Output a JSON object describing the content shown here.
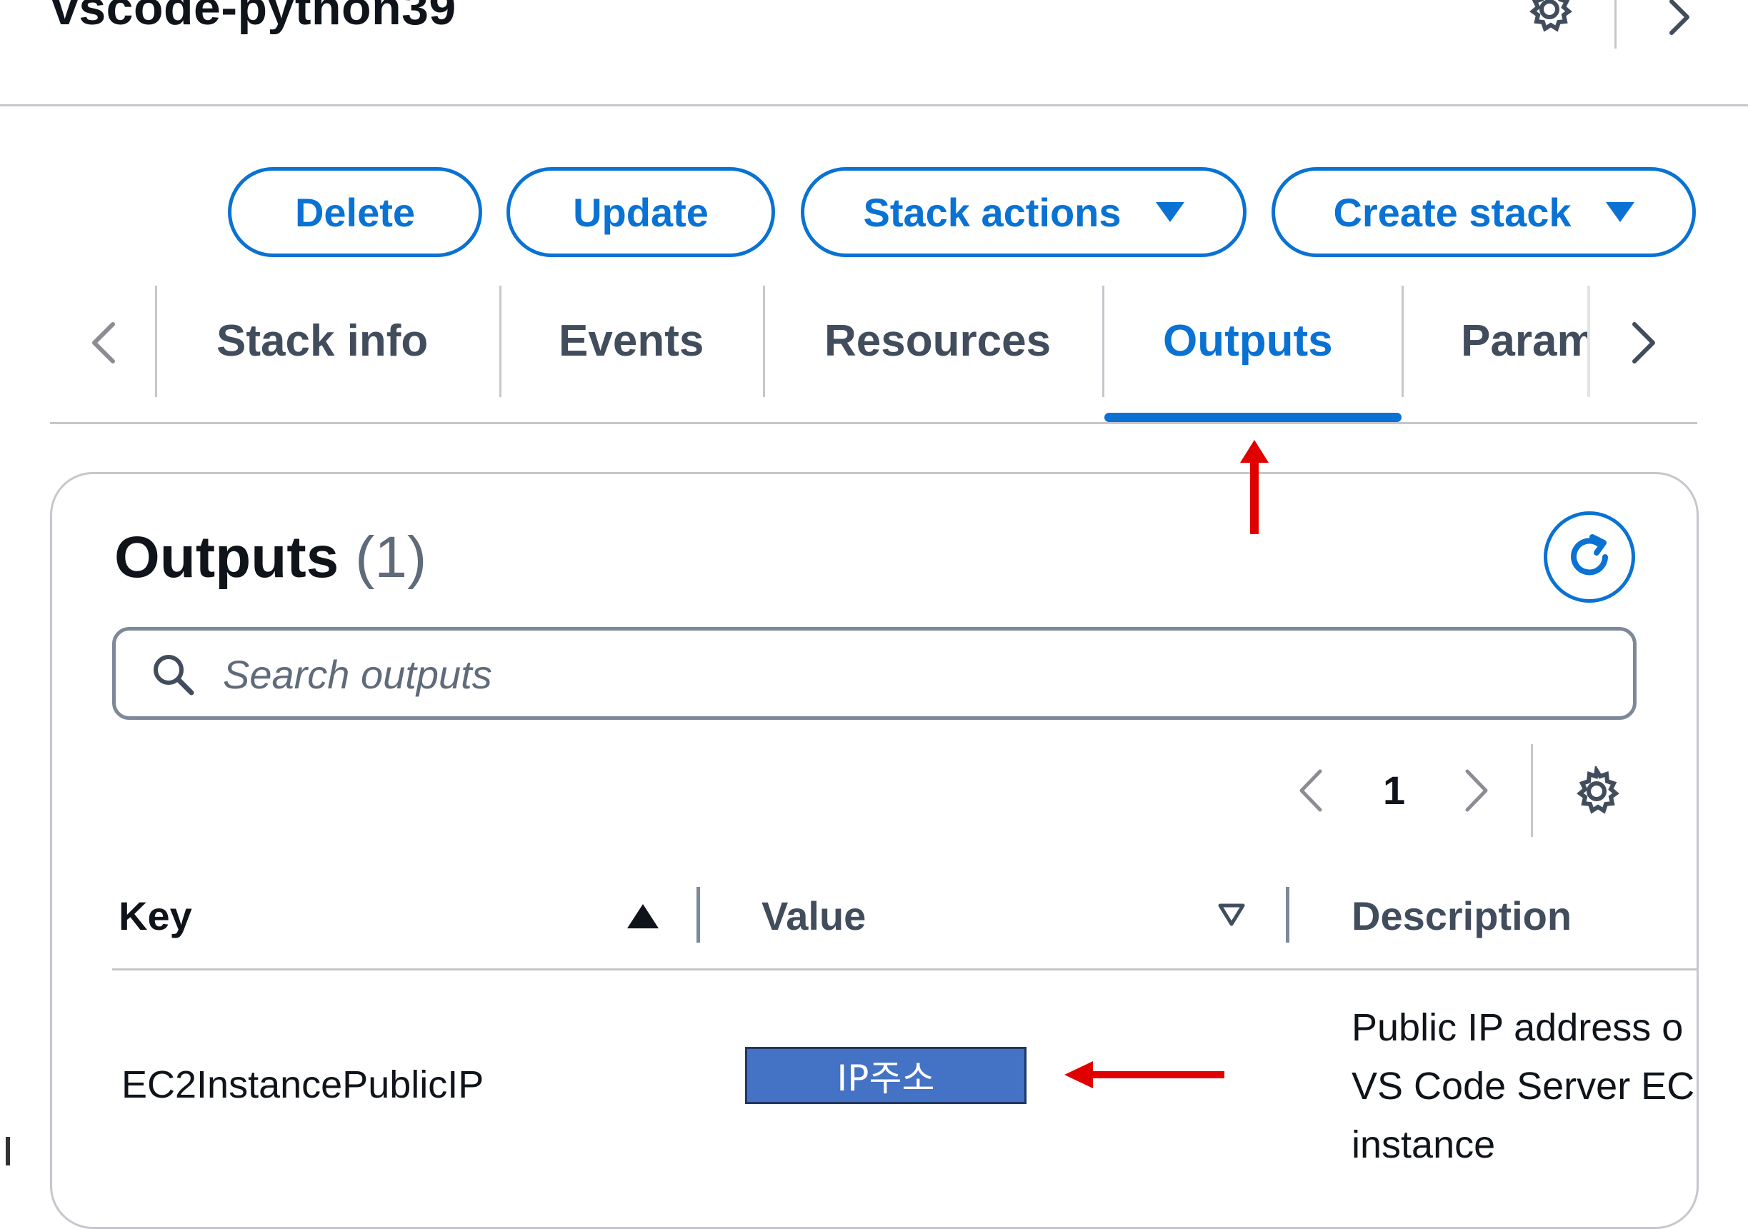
{
  "header": {
    "title": "vscode-python39",
    "settings_icon": "gear-icon",
    "next_icon": "chevron-right-icon"
  },
  "actions": {
    "delete_label": "Delete",
    "update_label": "Update",
    "stack_actions_label": "Stack actions",
    "create_stack_label": "Create stack"
  },
  "tabs": {
    "items": [
      {
        "label": "Stack info",
        "active": false
      },
      {
        "label": "Events",
        "active": false
      },
      {
        "label": "Resources",
        "active": false
      },
      {
        "label": "Outputs",
        "active": true
      },
      {
        "label": "Param",
        "active": false
      }
    ],
    "prev_icon": "chevron-left-icon",
    "next_icon": "chevron-right-icon"
  },
  "outputs_panel": {
    "title": "Outputs",
    "count": "(1)",
    "refresh_icon": "refresh-icon",
    "search": {
      "placeholder": "Search outputs",
      "value": ""
    },
    "pagination": {
      "current_page": "1",
      "prev_icon": "chevron-left-icon",
      "next_icon": "chevron-right-icon",
      "settings_icon": "gear-icon"
    },
    "table": {
      "columns": [
        {
          "label": "Key",
          "sort": "ascending"
        },
        {
          "label": "Value",
          "sort": "none"
        },
        {
          "label": "Description",
          "sort": "none"
        }
      ],
      "rows": [
        {
          "key": "EC2InstancePublicIP",
          "value": "IP주소",
          "description_lines": [
            "Public IP address o",
            "VS Code Server EC",
            "instance"
          ]
        }
      ]
    }
  },
  "colors": {
    "accent": "#0972d3",
    "annotation_arrow": "#e00000",
    "value_highlight": "#4472c4"
  }
}
